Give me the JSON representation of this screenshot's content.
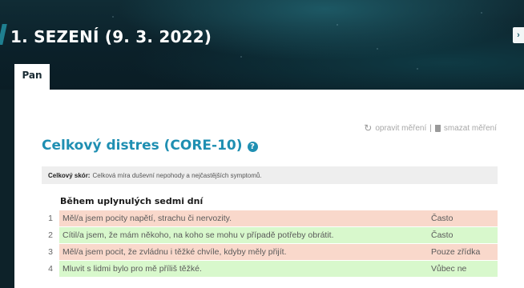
{
  "header": {
    "title": "1. SEZENÍ (9. 3. 2022)",
    "side_toggle": "›",
    "tab_label": "Pan"
  },
  "actions": {
    "refresh_icon": "refresh-icon",
    "edit_label": "opravit měření",
    "separator": "|",
    "trash_icon": "trash-icon",
    "delete_label": "smazat měření"
  },
  "section": {
    "title": "Celkový distres (CORE-10)",
    "help_glyph": "?"
  },
  "score": {
    "label": "Celkový skór:",
    "description": "Celková míra duševní nepohody a nejčastějších symptomů."
  },
  "period_heading": "Během uplynulých sedmi dní",
  "items": [
    {
      "num": "1",
      "question": "Měl/a jsem pocity napětí, strachu či nervozity.",
      "answer": "Často",
      "color": "#f9d8cb"
    },
    {
      "num": "2",
      "question": "Cítil/a jsem, že mám někoho, na koho se mohu v případě potřeby obrátit.",
      "answer": "Často",
      "color": "#d8f8cc"
    },
    {
      "num": "3",
      "question": "Měl/a jsem pocit, že zvládnu i těžké chvíle, kdyby měly přijít.",
      "answer": "Pouze zřídka",
      "color": "#f9d8cb"
    },
    {
      "num": "4",
      "question": "Mluvit s lidmi bylo pro mě příliš těžké.",
      "answer": "Vůbec ne",
      "color": "#d8f8cc"
    }
  ]
}
